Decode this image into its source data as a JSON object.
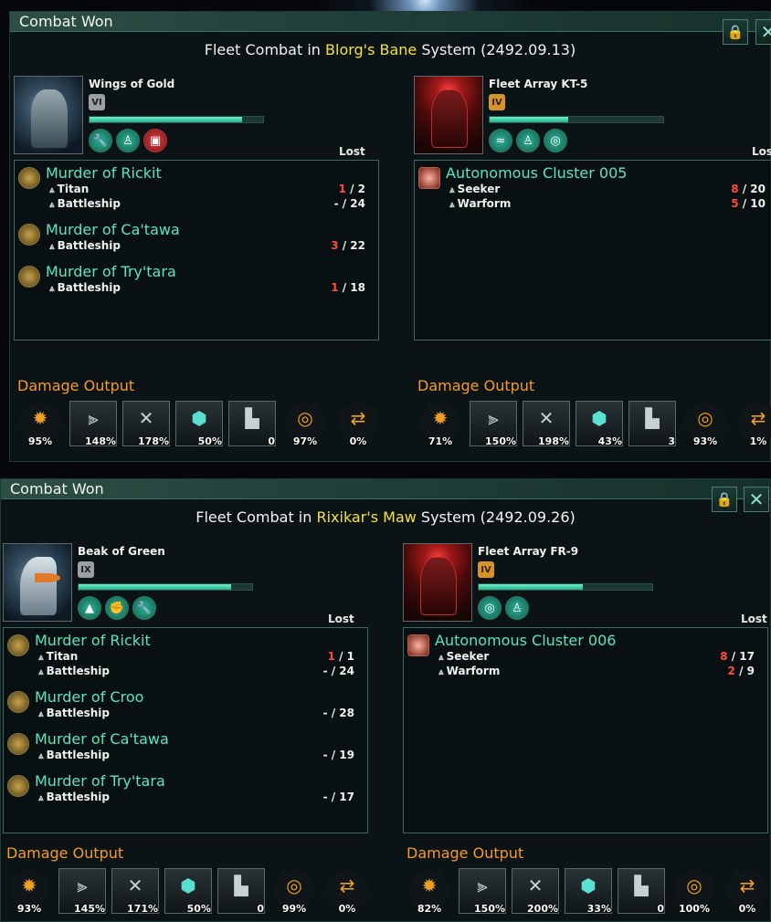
{
  "panels": [
    {
      "title": "Combat Won",
      "heading": {
        "pre": "Fleet Combat in ",
        "system": "Blorg's Bane",
        "post": " System (2492.09.13)"
      },
      "left": {
        "leader": "Wings of Gold",
        "rank": "VI",
        "xp": 0.88,
        "traits": [
          "wrench-icon",
          "body-icon",
          "toolbox-icon"
        ],
        "lost_label": "Lost",
        "fleets": [
          {
            "name": "Murder of Rickit",
            "ships": [
              {
                "cls": "Titan",
                "lost": "1",
                "sep": " / ",
                "total": "2"
              },
              {
                "cls": "Battleship",
                "lost": "-",
                "sep": " / ",
                "total": "24"
              }
            ]
          },
          {
            "name": "Murder of Ca'tawa",
            "ships": [
              {
                "cls": "Battleship",
                "lost": "3",
                "sep": " / ",
                "total": "22"
              }
            ]
          },
          {
            "name": "Murder of Try'tara",
            "ships": [
              {
                "cls": "Battleship",
                "lost": "1",
                "sep": " / ",
                "total": "18"
              }
            ]
          }
        ],
        "damage_title": "Damage Output",
        "damage": [
          "95%",
          "148%",
          "178%",
          "50%",
          "0",
          "97%",
          "0%"
        ]
      },
      "right": {
        "leader": "Fleet Array KT-5",
        "rank": "IV",
        "xp": 0.45,
        "traits": [
          "wave-icon",
          "body-icon",
          "spiral-icon"
        ],
        "lost_label": "Lost",
        "fleets": [
          {
            "name": "Autonomous Cluster 005",
            "ships": [
              {
                "cls": "Seeker",
                "lost": "8",
                "sep": " / ",
                "total": "20"
              },
              {
                "cls": "Warform",
                "lost": "5",
                "sep": " / ",
                "total": "10"
              }
            ]
          }
        ],
        "damage_title": "Damage Output",
        "damage": [
          "71%",
          "150%",
          "198%",
          "43%",
          "3",
          "93%",
          "1%"
        ]
      }
    },
    {
      "title": "Combat Won",
      "heading": {
        "pre": "Fleet Combat in ",
        "system": "Rixikar's Maw",
        "post": " System (2492.09.26)"
      },
      "left": {
        "leader": "Beak of Green",
        "rank": "IX",
        "xp": 0.88,
        "traits": [
          "rocket-icon",
          "fist-icon",
          "wrench-icon"
        ],
        "lost_label": "Lost",
        "fleets": [
          {
            "name": "Murder of Rickit",
            "ships": [
              {
                "cls": "Titan",
                "lost": "1",
                "sep": " / ",
                "total": "1"
              },
              {
                "cls": "Battleship",
                "lost": "-",
                "sep": " / ",
                "total": "24"
              }
            ]
          },
          {
            "name": "Murder of Croo",
            "ships": [
              {
                "cls": "Battleship",
                "lost": "-",
                "sep": " / ",
                "total": "28"
              }
            ]
          },
          {
            "name": "Murder of Ca'tawa",
            "ships": [
              {
                "cls": "Battleship",
                "lost": "-",
                "sep": " / ",
                "total": "19"
              }
            ]
          },
          {
            "name": "Murder of Try'tara",
            "ships": [
              {
                "cls": "Battleship",
                "lost": "-",
                "sep": " / ",
                "total": "17"
              }
            ]
          }
        ],
        "damage_title": "Damage Output",
        "damage": [
          "93%",
          "145%",
          "171%",
          "50%",
          "0",
          "99%",
          "0%"
        ]
      },
      "right": {
        "leader": "Fleet Array FR-9",
        "rank": "IV",
        "xp": 0.6,
        "traits": [
          "spiral-icon",
          "body-icon"
        ],
        "lost_label": "Lost",
        "fleets": [
          {
            "name": "Autonomous Cluster 006",
            "ships": [
              {
                "cls": "Seeker",
                "lost": "8",
                "sep": " / ",
                "total": "17"
              },
              {
                "cls": "Warform",
                "lost": "2",
                "sep": " / ",
                "total": "9"
              }
            ]
          }
        ],
        "damage_title": "Damage Output",
        "damage": [
          "82%",
          "150%",
          "200%",
          "33%",
          "0",
          "100%",
          "0%"
        ]
      }
    }
  ],
  "icons": {
    "lock": "lock-icon",
    "close": "close-icon",
    "damage_types": [
      "explosion-icon",
      "missile-icon",
      "shard-icon",
      "hex-shield-icon",
      "turret-icon",
      "target-icon",
      "shuffle-icon"
    ]
  },
  "colors": {
    "accent": "#57e6bd",
    "system": "#f2e23a",
    "damage_title": "#f49a2a",
    "lost": "#ff4a3a"
  }
}
